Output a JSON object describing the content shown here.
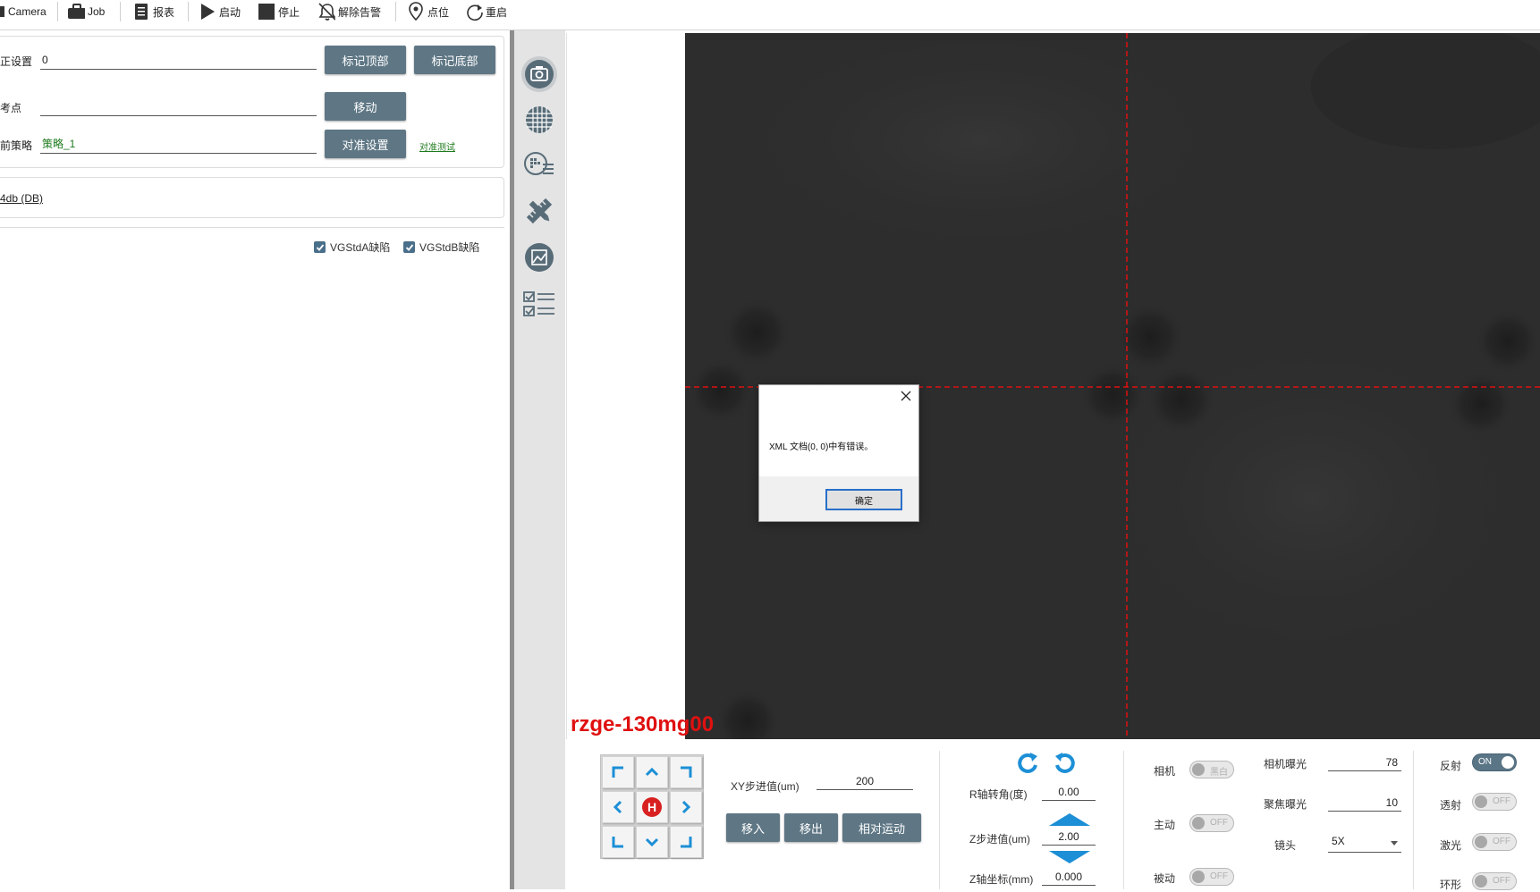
{
  "toolbar": {
    "items": [
      {
        "label": "Camera",
        "icon": "camera-icon"
      },
      {
        "label": "Job",
        "icon": "briefcase-icon"
      },
      {
        "label": "报表",
        "icon": "report-icon"
      },
      {
        "label": "启动",
        "icon": "play-icon"
      },
      {
        "label": "停止",
        "icon": "stop-icon"
      },
      {
        "label": "解除告警",
        "icon": "bell-off-icon"
      },
      {
        "label": "点位",
        "icon": "location-pin-icon"
      },
      {
        "label": "重启",
        "icon": "restart-icon"
      }
    ]
  },
  "left": {
    "row1": {
      "label": "正设置",
      "value": "0",
      "btn_top": "标记顶部",
      "btn_bottom": "标记底部"
    },
    "row2": {
      "label": "考点",
      "value": "",
      "btn_move": "移动"
    },
    "row3": {
      "label": "前策略",
      "value": "策略_1",
      "btn_align": "对准设置",
      "link": "对准测试"
    },
    "db_label": "4db (DB)",
    "checks": [
      {
        "label": "VGStdA缺陷",
        "checked": true
      },
      {
        "label": "VGStdB缺陷",
        "checked": true
      }
    ]
  },
  "rail": {
    "icons": [
      "camera-icon",
      "grid-globe-icon",
      "globe-list-icon",
      "ruler-pencil-icon",
      "image-frame-icon",
      "checklist-icon"
    ]
  },
  "camera": {
    "name": "rzge-130mg00",
    "crosshair_color": "#e01010"
  },
  "dialog": {
    "message": "XML 文档(0, 0)中有错误。",
    "ok": "确定"
  },
  "controls": {
    "xy_step_label": "XY步进值(um)",
    "xy_step_value": "200",
    "btn_move_in": "移入",
    "btn_move_out": "移出",
    "btn_relative": "相对运动",
    "r_angle_label": "R轴转角(度)",
    "r_angle_value": "0.00",
    "z_step_label": "Z步进值(um)",
    "z_step_value": "2.00",
    "z_coord_label": "Z轴坐标(mm)",
    "z_coord_value": "0.000",
    "camera_label": "相机",
    "camera_toggle": "黑白",
    "active_label": "主动",
    "active_toggle": "OFF",
    "passive_label": "被动",
    "passive_toggle": "OFF",
    "cam_exposure_label": "相机曝光",
    "cam_exposure_value": "78",
    "focus_exposure_label": "聚焦曝光",
    "focus_exposure_value": "10",
    "lens_label": "镜头",
    "lens_value": "5X",
    "reflect_label": "反射",
    "reflect_toggle": "ON",
    "transmit_label": "透射",
    "transmit_toggle": "OFF",
    "laser_label": "激光",
    "laser_toggle": "OFF",
    "ring_label": "环形",
    "ring_toggle": "OFF"
  },
  "colors": {
    "accent": "#5f7785",
    "toggle_on": "#5a7586",
    "jog_arrow": "#1c8fd6",
    "home": "#d82020"
  }
}
